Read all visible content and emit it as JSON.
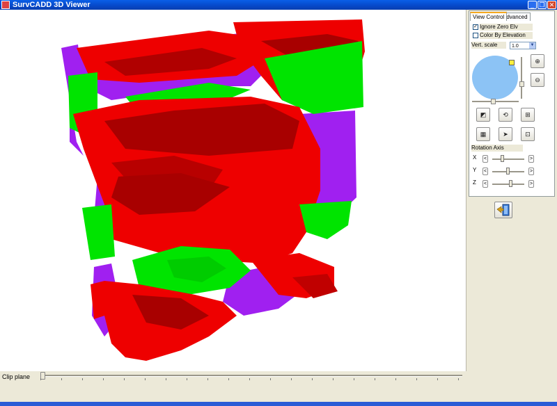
{
  "window": {
    "title": "SurvCADD 3D Viewer",
    "min_glyph": "_",
    "max_glyph": "❐",
    "close_glyph": "✕"
  },
  "tabs": [
    {
      "label": "View Control",
      "active": true
    },
    {
      "label": "Advanced",
      "active": false
    }
  ],
  "options": {
    "ignore_zero_elv": {
      "label": "Ignore Zero Elv",
      "checked": true
    },
    "color_by_elevation": {
      "label": "Color By Elevation",
      "checked": false
    }
  },
  "vert_scale": {
    "label": "Vert. scale",
    "value": "1.0"
  },
  "rotation": {
    "header": "Rotation Axis",
    "axes": [
      {
        "label": "X",
        "left": "<",
        "right": ">",
        "level": 0.3
      },
      {
        "label": "Y",
        "left": "<",
        "right": ">",
        "level": 0.5
      },
      {
        "label": "Z",
        "left": "<",
        "right": ">",
        "level": 0.6
      }
    ]
  },
  "clip_plane": {
    "label": "Clip plane",
    "level": 0.0
  },
  "icons": {
    "zoom_in": "zoom-in-icon",
    "zoom_out": "zoom-out-icon",
    "exit": "exit-door-icon"
  },
  "colors": {
    "model_red": "#EE0000",
    "model_dark_red": "#A80000",
    "model_green": "#00E400",
    "model_purple": "#A020F0",
    "globe": "#8CC3F5",
    "title_bar": "#0A5FE8"
  }
}
